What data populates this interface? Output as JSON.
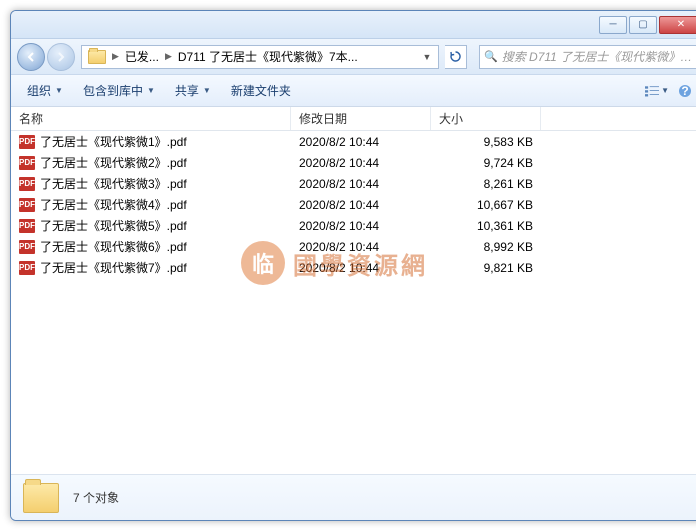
{
  "breadcrumb": {
    "seg1": "已发...",
    "seg2": "D711 了无居士《现代紫微》7本..."
  },
  "search": {
    "placeholder": "搜索 D711 了无居士《现代紫微》7..."
  },
  "toolbar": {
    "organize": "组织",
    "include": "包含到库中",
    "share": "共享",
    "newfolder": "新建文件夹"
  },
  "columns": {
    "name": "名称",
    "date": "修改日期",
    "size": "大小"
  },
  "files": [
    {
      "name": "了无居士《现代紫微1》.pdf",
      "date": "2020/8/2 10:44",
      "size": "9,583 KB"
    },
    {
      "name": "了无居士《现代紫微2》.pdf",
      "date": "2020/8/2 10:44",
      "size": "9,724 KB"
    },
    {
      "name": "了无居士《现代紫微3》.pdf",
      "date": "2020/8/2 10:44",
      "size": "8,261 KB"
    },
    {
      "name": "了无居士《现代紫微4》.pdf",
      "date": "2020/8/2 10:44",
      "size": "10,667 KB"
    },
    {
      "name": "了无居士《现代紫微5》.pdf",
      "date": "2020/8/2 10:44",
      "size": "10,361 KB"
    },
    {
      "name": "了无居士《现代紫微6》.pdf",
      "date": "2020/8/2 10:44",
      "size": "8,992 KB"
    },
    {
      "name": "了无居士《现代紫微7》.pdf",
      "date": "2020/8/2 10:44",
      "size": "9,821 KB"
    }
  ],
  "status": {
    "count": "7 个对象"
  },
  "watermark": {
    "badge": "临",
    "text": "國學資源網"
  },
  "pdf_label": "PDF"
}
